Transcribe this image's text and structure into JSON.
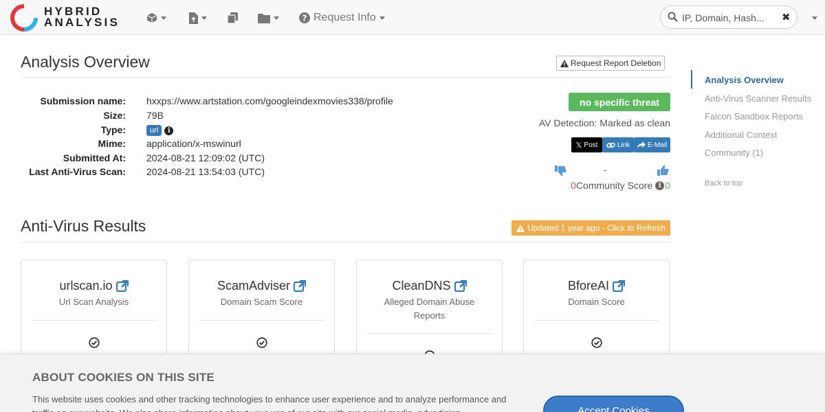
{
  "brand": {
    "line1": "HYBRID",
    "line2": "ANALYSIS"
  },
  "nav": {
    "request_info": "Request Info"
  },
  "search": {
    "placeholder": "IP, Domain, Hash..."
  },
  "overview": {
    "title": "Analysis Overview",
    "delete_button": "Request Report Deletion",
    "fields": [
      {
        "label": "Submission name:",
        "value": "hxxps://www.artstation.com/googleindexmovies338/profile"
      },
      {
        "label": "Size:",
        "value": "79B"
      },
      {
        "label": "Type:",
        "value": "url"
      },
      {
        "label": "Mime:",
        "value": "application/x-mswinurl"
      },
      {
        "label": "Submitted At:",
        "value": "2024-08-21 12:09:02 (UTC)"
      },
      {
        "label": "Last Anti-Virus Scan:",
        "value": "2024-08-21 13:54:03 (UTC)"
      }
    ],
    "threat_badge": "no specific threat",
    "av_detection": "AV Detection: Marked as clean",
    "share": {
      "post": "Post",
      "link": "Link",
      "email": "E-Mail"
    },
    "community": {
      "dash": "-",
      "down": "0",
      "label": "Community Score",
      "up": "0"
    }
  },
  "sidebar": {
    "items": [
      {
        "label": "Analysis Overview",
        "active": true
      },
      {
        "label": "Anti-Virus Scanner Results",
        "active": false
      },
      {
        "label": "Falcon Sandbox Reports",
        "active": false
      },
      {
        "label": "Additional Context",
        "active": false
      },
      {
        "label": "Community (1)",
        "active": false
      }
    ],
    "back_to_top": "Back to top"
  },
  "av_results": {
    "title": "Anti-Virus Results",
    "refresh": "Updated 1 year ago - Click to Refresh",
    "cards": [
      {
        "name": "urlscan.io",
        "subtitle": "Url Scan Analysis"
      },
      {
        "name": "ScamAdviser",
        "subtitle": "Domain Scam Score"
      },
      {
        "name": "CleanDNS",
        "subtitle": "Alleged Domain Abuse Reports"
      },
      {
        "name": "BforeAI",
        "subtitle": "Domain Score"
      }
    ]
  },
  "cookies": {
    "title": "ABOUT COOKIES ON THIS SITE",
    "text": "This website uses cookies and other tracking technologies to enhance user experience and to analyze performance and traffic on our website. We also share information about your use of our site with our social media, advertising",
    "accept": "Accept Cookies"
  },
  "colors": {
    "brand_blue": "#337ab7",
    "threat_green": "#5cb85c",
    "refresh_orange": "#f0ad4e",
    "logo_red": "#e03a3e",
    "logo_cyan": "#29b6e8"
  }
}
